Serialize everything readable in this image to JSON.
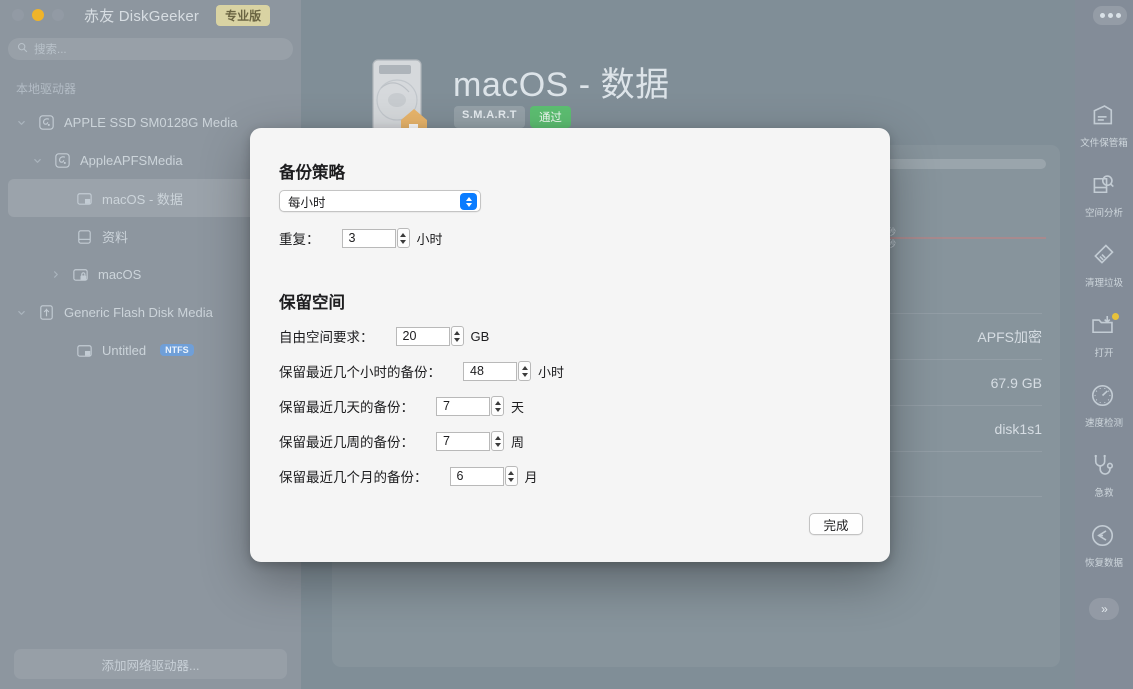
{
  "window": {
    "app_title": "赤友 DiskGeeker",
    "pro_badge": "专业版",
    "menu_icon": "overflow-menu-icon"
  },
  "sidebar": {
    "search": {
      "placeholder": "搜索...",
      "icon": "search-icon"
    },
    "section_label": "本地驱动器",
    "items": [
      {
        "label": "APPLE SSD SM0128G Media",
        "icon": "disk-icon",
        "indent": 0,
        "twisty": "down",
        "selected": false,
        "badge": ""
      },
      {
        "label": "AppleAPFSMedia",
        "icon": "disk-icon",
        "indent": 1,
        "twisty": "down",
        "selected": false,
        "badge": ""
      },
      {
        "label": "macOS - 数据",
        "icon": "volume-icon",
        "indent": 2,
        "twisty": "",
        "selected": true,
        "badge": ""
      },
      {
        "label": "资料",
        "icon": "folder-vol-icon",
        "indent": 2,
        "twisty": "",
        "selected": false,
        "badge": ""
      },
      {
        "label": "macOS",
        "icon": "locked-volume-icon",
        "indent": 3,
        "twisty": "right",
        "selected": false,
        "badge": ""
      },
      {
        "label": "Generic Flash Disk Media",
        "icon": "usb-icon",
        "indent": 0,
        "twisty": "down",
        "selected": false,
        "badge": ""
      },
      {
        "label": "Untitled",
        "icon": "volume-icon",
        "indent": 2,
        "twisty": "",
        "selected": false,
        "badge": "NTFS"
      }
    ],
    "add_network_drive": "添加网络驱动器..."
  },
  "main": {
    "volume_title": "macOS - 数据",
    "smart_key": "S.M.A.R.T",
    "smart_value": "通过",
    "smart_color": "#5dbf72",
    "chart_labels": [
      "B/秒",
      "B/秒"
    ],
    "info_rows": [
      {
        "value": "APFS加密"
      },
      {
        "value": "67.9 GB"
      },
      {
        "value": "disk1s1"
      }
    ]
  },
  "rail": {
    "items": [
      {
        "label": "文件保管箱",
        "icon": "file-vault-icon",
        "badge": false
      },
      {
        "label": "空间分析",
        "icon": "space-analyze-icon",
        "badge": false
      },
      {
        "label": "清理垃圾",
        "icon": "clean-junk-icon",
        "badge": false
      },
      {
        "label": "打开",
        "icon": "open-folder-icon",
        "badge": true
      },
      {
        "label": "速度检测",
        "icon": "speed-test-icon",
        "badge": false
      },
      {
        "label": "急救",
        "icon": "first-aid-icon",
        "badge": false
      },
      {
        "label": "恢复数据",
        "icon": "recover-data-icon",
        "badge": false
      }
    ],
    "more_label": "»"
  },
  "modal": {
    "strategy_heading": "备份策略",
    "frequency": {
      "value": "每小时",
      "icon": "popup-arrows-icon"
    },
    "repeat": {
      "label": "重复：",
      "value": "3",
      "unit": "小时"
    },
    "space_heading": "保留空间",
    "rows": [
      {
        "label": "自由空间要求：",
        "value": "20",
        "unit": "GB",
        "field_w": 54,
        "gap": 22
      },
      {
        "label": "保留最近几个小时的备份：",
        "value": "48",
        "unit": "小时",
        "field_w": 54,
        "gap": 22
      },
      {
        "label": "保留最近几天的备份：",
        "value": "7",
        "unit": "天",
        "field_w": 54,
        "gap": 22
      },
      {
        "label": "保留最近几周的备份：",
        "value": "7",
        "unit": "周",
        "field_w": 54,
        "gap": 22
      },
      {
        "label": "保留最近几个月的备份：",
        "value": "6",
        "unit": "月",
        "field_w": 54,
        "gap": 22
      }
    ],
    "done_label": "完成",
    "accent_color": "#0a7cff"
  }
}
